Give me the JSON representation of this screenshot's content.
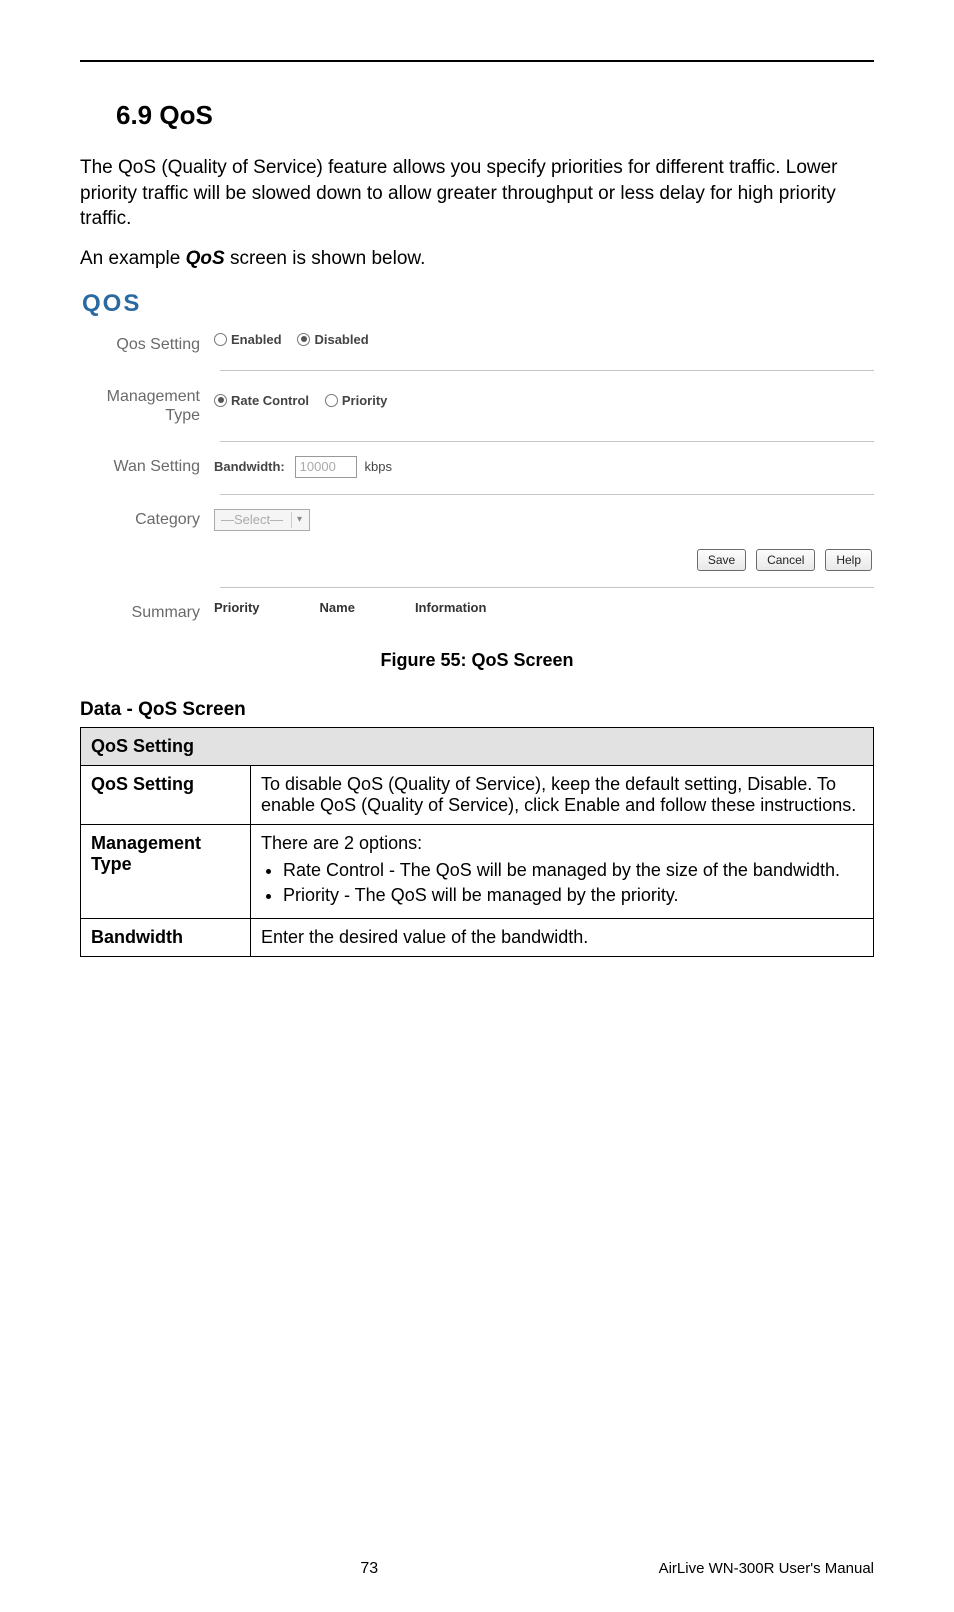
{
  "heading": "6.9  QoS",
  "intro1": "The QoS (Quality of Service) feature allows you specify priorities for different traffic. Lower priority traffic will be slowed down to allow greater throughput or less delay for high priority traffic.",
  "intro2_pre": "An example ",
  "intro2_em": "QoS",
  "intro2_post": " screen is shown below.",
  "shot": {
    "title": "QOS",
    "rows": {
      "qos_setting": {
        "label": "Qos Setting",
        "enabled": "Enabled",
        "disabled": "Disabled"
      },
      "mgmt": {
        "label": "Management Type",
        "rate": "Rate Control",
        "priority": "Priority"
      },
      "wan": {
        "label": "Wan Setting",
        "bw_label": "Bandwidth:",
        "bw_value": "10000",
        "bw_unit": "kbps"
      },
      "category": {
        "label": "Category",
        "select_text": "—Select—"
      },
      "buttons": {
        "save": "Save",
        "cancel": "Cancel",
        "help": "Help"
      },
      "summary": {
        "label": "Summary",
        "col1": "Priority",
        "col2": "Name",
        "col3": "Information"
      }
    }
  },
  "figure_caption": "Figure 55: QoS Screen",
  "data_heading": "Data - QoS Screen",
  "table": {
    "section": "QoS Setting",
    "rows": [
      {
        "k": "QoS Setting",
        "v": "To disable QoS (Quality of Service), keep the default setting, Disable. To enable QoS (Quality of Service), click Enable and follow these instructions."
      },
      {
        "k": "Management Type",
        "v_intro": "There are 2 options:",
        "v_li1": "Rate Control - The QoS will be managed by the size of the bandwidth.",
        "v_li2": "Priority - The QoS will be managed by the priority."
      },
      {
        "k": "Bandwidth",
        "v": "Enter the desired value of the bandwidth."
      }
    ]
  },
  "footer": {
    "page": "73",
    "manual": "AirLive WN-300R User's Manual"
  }
}
